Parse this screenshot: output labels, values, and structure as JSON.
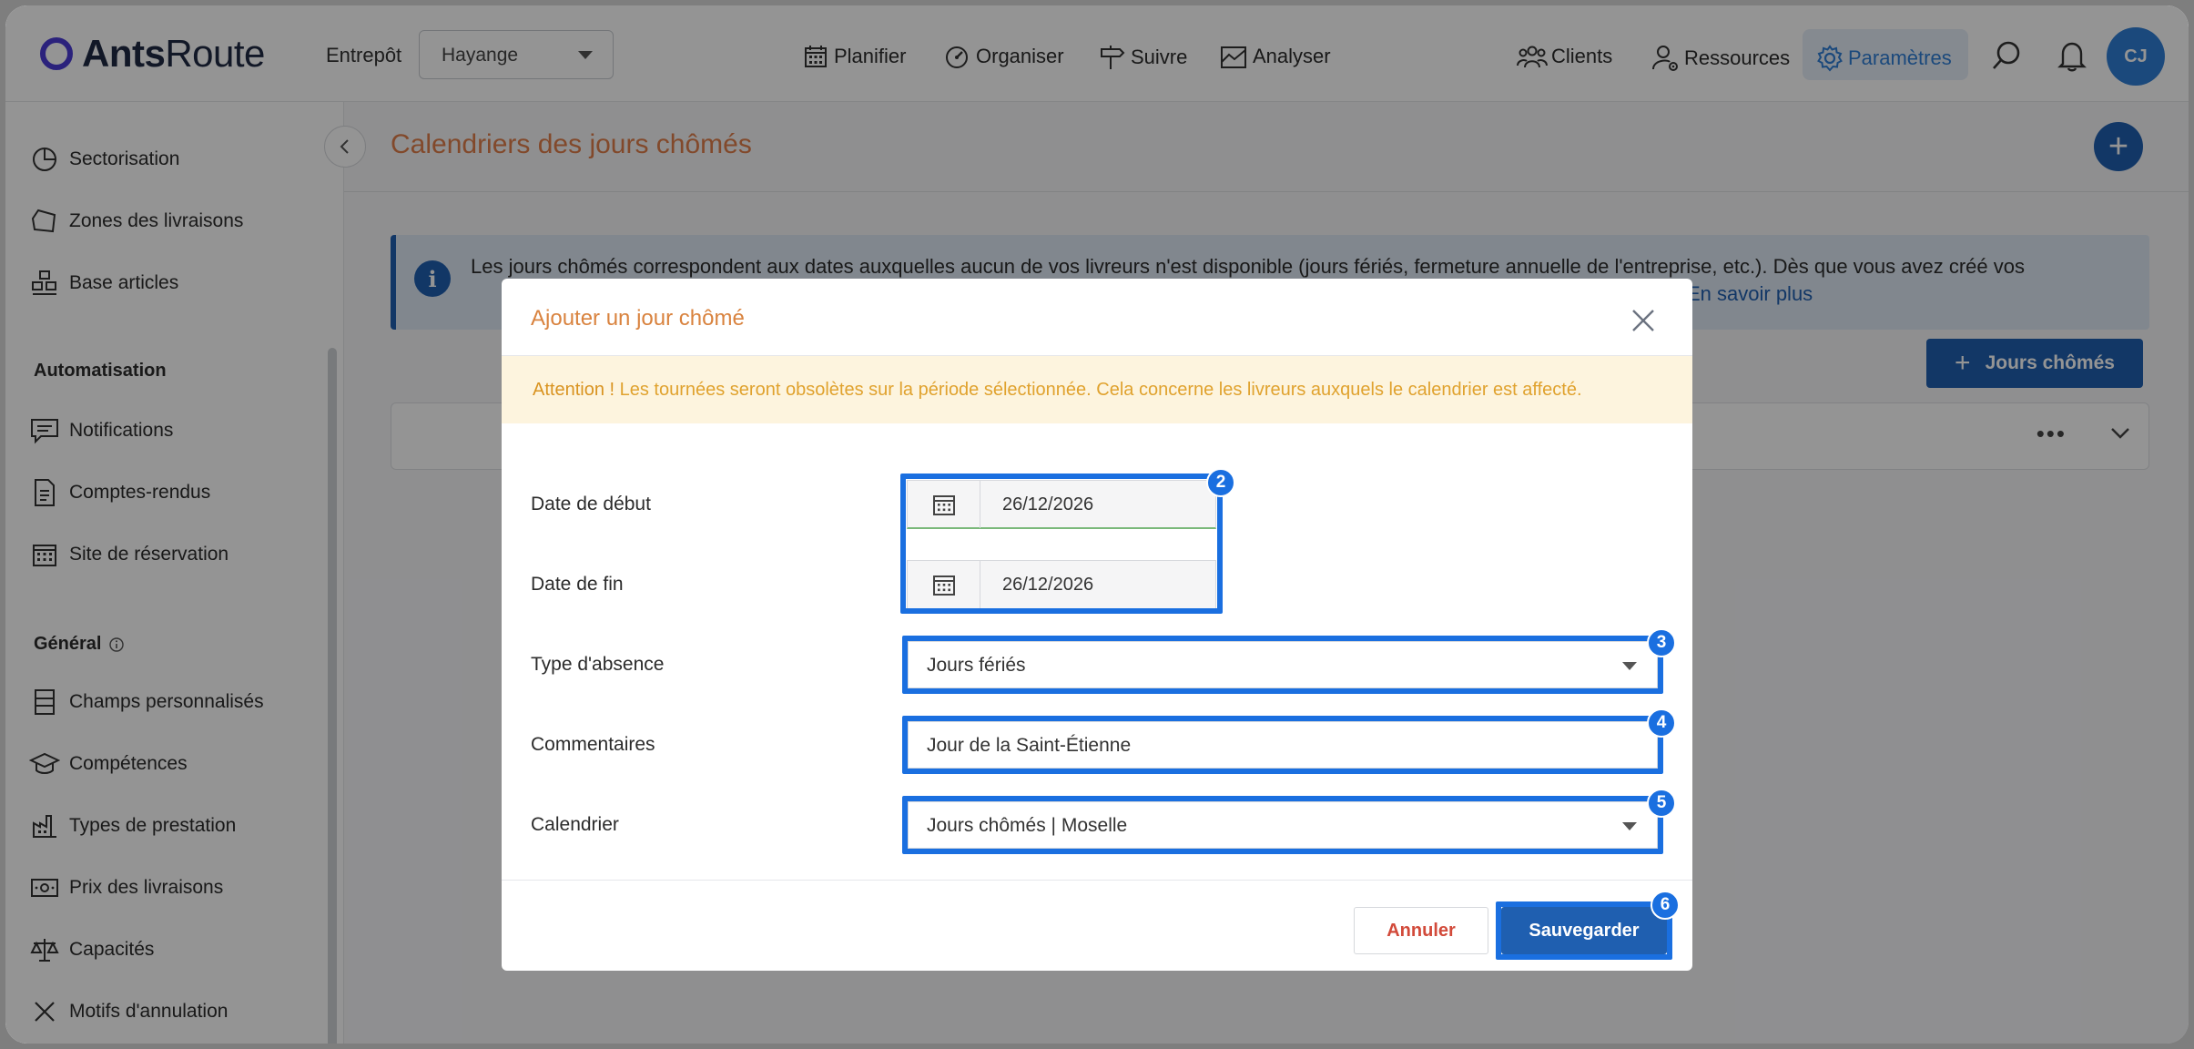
{
  "header": {
    "logo_bold": "Ants",
    "logo_light": "Route",
    "warehouse_label": "Entrepôt",
    "warehouse_value": "Hayange",
    "nav": [
      {
        "label": "Planifier",
        "icon": "calendar-grid-icon"
      },
      {
        "label": "Organiser",
        "icon": "gauge-icon"
      },
      {
        "label": "Suivre",
        "icon": "signpost-icon"
      },
      {
        "label": "Analyser",
        "icon": "chart-icon"
      }
    ],
    "right_nav": [
      {
        "label": "Clients",
        "icon": "users-icon"
      },
      {
        "label": "Ressources",
        "icon": "user-gear-icon"
      },
      {
        "label": "Paramètres",
        "icon": "gear-icon"
      }
    ],
    "avatar_initials": "CJ",
    "active_color": "#2f7fd6"
  },
  "sidebar": {
    "items_top": [
      {
        "label": "Sectorisation",
        "icon": "pie-chart-icon"
      },
      {
        "label": "Zones des livraisons",
        "icon": "polygon-zone-icon"
      },
      {
        "label": "Base articles",
        "icon": "boxes-icon"
      }
    ],
    "section_automation": "Automatisation",
    "items_automation": [
      {
        "label": "Notifications",
        "icon": "message-icon"
      },
      {
        "label": "Comptes-rendus",
        "icon": "document-icon"
      },
      {
        "label": "Site de réservation",
        "icon": "calendar-icon"
      }
    ],
    "section_general": "Général",
    "items_general": [
      {
        "label": "Champs personnalisés",
        "icon": "fields-icon"
      },
      {
        "label": "Compétences",
        "icon": "graduation-cap-icon"
      },
      {
        "label": "Types de prestation",
        "icon": "factory-icon"
      },
      {
        "label": "Prix des livraisons",
        "icon": "money-icon"
      },
      {
        "label": "Capacités",
        "icon": "scale-icon"
      },
      {
        "label": "Motifs d'annulation",
        "icon": "x-icon"
      }
    ]
  },
  "main": {
    "title": "Calendriers des jours chômés",
    "info_text": "Les jours chômés correspondent aux dates auxquelles aucun de vos livreurs n'est disponible (jours fériés, fermeture annuelle de l'entreprise, etc.). Dès que vous avez créé vos",
    "info_more": "En savoir plus",
    "add_button": "Jours chômés"
  },
  "modal": {
    "title": "Ajouter un jour chômé",
    "warning_bold": "Attention !",
    "warning_text": " Les tournées seront obsolètes sur la période sélectionnée. Cela concerne les livreurs auxquels le calendrier est affecté.",
    "start_label": "Date de début",
    "start_value": "26/12/2026",
    "end_label": "Date de fin",
    "end_value": "26/12/2026",
    "type_label": "Type d'absence",
    "type_value": "Jours fériés",
    "comment_label": "Commentaires",
    "comment_value": "Jour de la Saint-Étienne",
    "calendar_label": "Calendrier",
    "calendar_value": "Jours chômés | Moselle",
    "cancel": "Annuler",
    "save": "Sauvegarder",
    "badges": [
      "2",
      "3",
      "4",
      "5",
      "6"
    ],
    "highlight_color": "#1a6fe0"
  }
}
